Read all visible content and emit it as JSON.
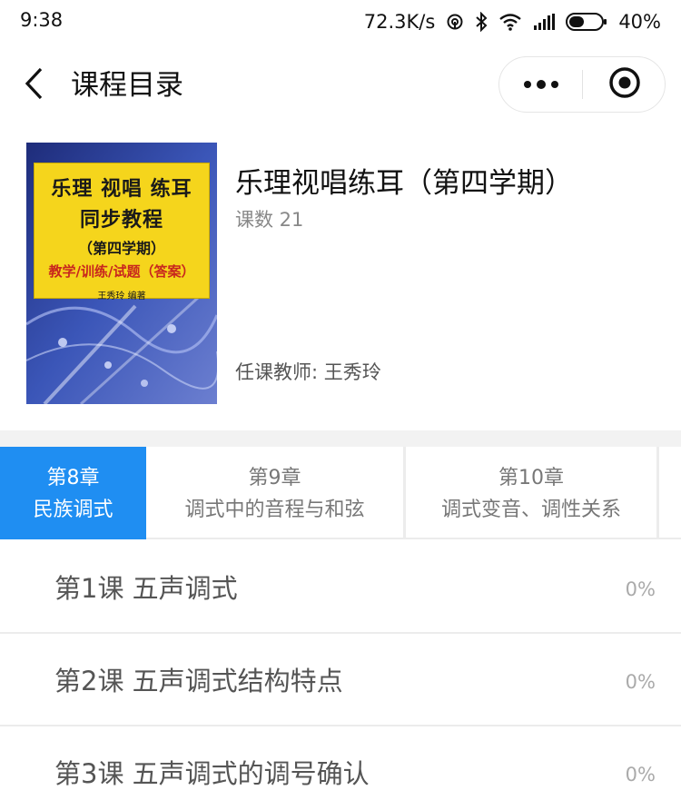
{
  "status_bar": {
    "time": "9:38",
    "network_speed": "72.3K/s",
    "battery": "40%",
    "icons": [
      "hotspot-icon",
      "bluetooth-icon",
      "wifi-icon",
      "signal-icon",
      "battery-icon"
    ]
  },
  "nav": {
    "title": "课程目录",
    "back_icon": "chevron-left-icon",
    "more_icon": "more-dots-icon",
    "close_icon": "target-close-icon"
  },
  "course": {
    "title": "乐理视唱练耳（第四学期）",
    "count_label": "课数 21",
    "teacher_label": "任课教师: 王秀玲",
    "cover": {
      "line1": "乐理 视唱 练耳",
      "line2": "同步教程",
      "line3": "（第四学期）",
      "line4": "教学/训练/试题（答案）",
      "line5": "王秀玲  编著"
    }
  },
  "chapters": [
    {
      "num": "第8章",
      "name": "民族调式",
      "active": true
    },
    {
      "num": "第9章",
      "name": "调式中的音程与和弦",
      "active": false
    },
    {
      "num": "第10章",
      "name": "调式变音、调性关系",
      "active": false
    }
  ],
  "lessons": [
    {
      "title": "第1课 五声调式",
      "progress": "0%"
    },
    {
      "title": "第2课 五声调式结构特点",
      "progress": "0%"
    },
    {
      "title": "第3课 五声调式的调号确认",
      "progress": "0%"
    }
  ],
  "colors": {
    "accent": "#1f8ef2",
    "cover_yellow": "#f5d51c",
    "cover_blue": "#2a3d8f"
  }
}
